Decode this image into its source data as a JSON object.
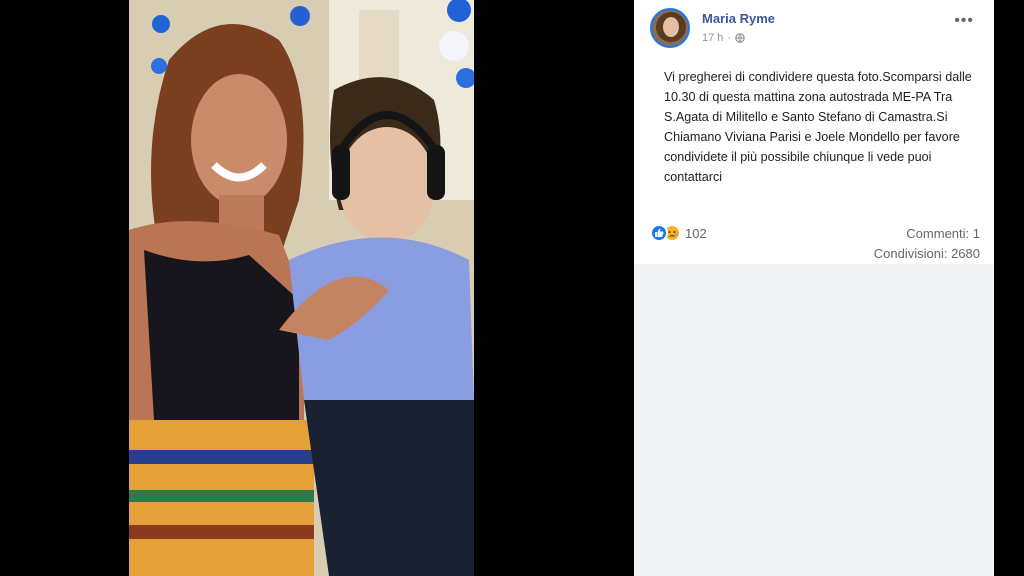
{
  "post": {
    "author": "Maria Ryme",
    "time": "17 h",
    "meta_sep": "·",
    "text": "Vi pregherei di condividere questa foto.Scomparsi dalle 10.30 di questa mattina zona autostrada ME-PA Tra S.Agata di Militello e Santo Stefano di Camastra.Si Chiamano Viviana Parisi e Joele Mondello per favore condividete il più possibile chiunque li vede puoi contattarci",
    "more_label": "•••",
    "privacy_icon": "globe-icon"
  },
  "stats": {
    "reaction_count": "102",
    "reaction_icons": [
      "like-icon",
      "sad-icon"
    ],
    "comments": "Commenti: 1",
    "shares": "Condivisioni: 2680"
  },
  "colors": {
    "author_link": "#385898",
    "like_blue": "#1877f2",
    "sad_yellow": "#f7b125",
    "panel_background": "#ffffff",
    "panel_bottom": "#f2f3f5"
  }
}
